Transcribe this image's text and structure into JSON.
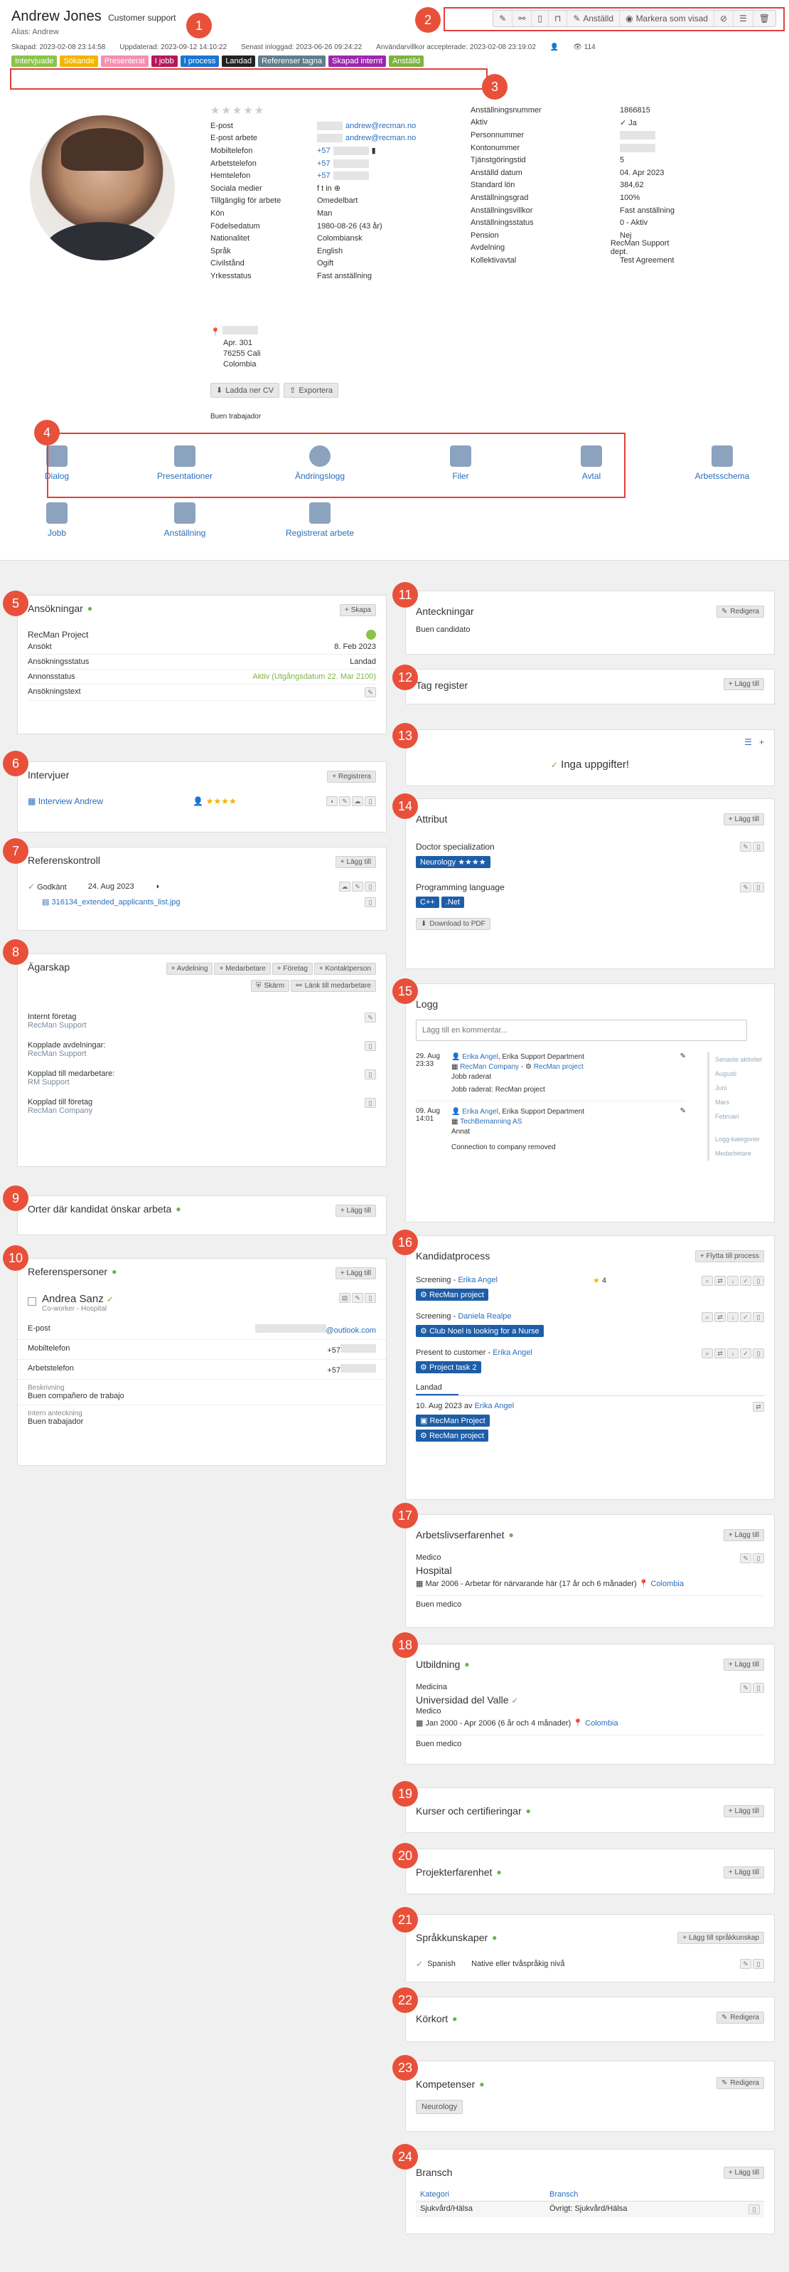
{
  "header": {
    "name": "Andrew Jones",
    "role": "Customer support",
    "alias": "Alias: Andrew",
    "meta": [
      "Skapad: 2023-02-08 23:14:58",
      "Uppdaterad: 2023-09-12 14:10:22",
      "Senast inloggad: 2023-06-26 09:24:22",
      "Användarvillkor accepterade: 2023-02-08 23:19:02"
    ],
    "views": "114"
  },
  "toolbar": {
    "employee": "Anställd",
    "mark_seen": "Markera som visad"
  },
  "tags": [
    {
      "label": "Intervjuade",
      "color": "#8bc34a"
    },
    {
      "label": "Sökande",
      "color": "#f4b400"
    },
    {
      "label": "Presenterat",
      "color": "#f48fb1"
    },
    {
      "label": "I jobb",
      "color": "#b5195b"
    },
    {
      "label": "I process",
      "color": "#1976d2"
    },
    {
      "label": "Landad",
      "color": "#222222"
    },
    {
      "label": "Referenser tagna",
      "color": "#607d8b"
    },
    {
      "label": "Skapad internt",
      "color": "#9c27b0"
    },
    {
      "label": "Anställd",
      "color": "#7cb342"
    }
  ],
  "profile": {
    "stars": "★★★★★",
    "fields": [
      {
        "label": "E-post",
        "value": "andrew@recman.no"
      },
      {
        "label": "E-post arbete",
        "value": "andrew@recman.no"
      },
      {
        "label": "Mobiltelefon",
        "value": "+57"
      },
      {
        "label": "Arbetstelefon",
        "value": "+57"
      },
      {
        "label": "Hemtelefon",
        "value": "+57"
      },
      {
        "label": "Sociala medier",
        "value": "f  t  in  ⊕"
      },
      {
        "label": "Tillgänglig för arbete",
        "value": "Omedelbart"
      },
      {
        "label": "Kön",
        "value": "Man"
      },
      {
        "label": "Födelsedatum",
        "value": "1980-08-26 (43 år)"
      },
      {
        "label": "Nationalitet",
        "value": "Colombiansk"
      },
      {
        "label": "Språk",
        "value": "English"
      },
      {
        "label": "Civilstånd",
        "value": "Ogift"
      },
      {
        "label": "Yrkesstatus",
        "value": "Fast anställning"
      }
    ],
    "right": [
      {
        "label": "Anställningsnummer",
        "value": "1866815"
      },
      {
        "label": "Aktiv",
        "value": "✓ Ja"
      },
      {
        "label": "Personnummer",
        "value": ""
      },
      {
        "label": "Kontonummer",
        "value": ""
      },
      {
        "label": "Tjänstgöringstid",
        "value": "5"
      },
      {
        "label": "Anställd datum",
        "value": "04. Apr 2023"
      },
      {
        "label": "Standard lön",
        "value": "384,62"
      },
      {
        "label": "Anställningsgrad",
        "value": "100%"
      },
      {
        "label": "Anställningsvillkor",
        "value": "Fast anställning"
      },
      {
        "label": "Anställningsstatus",
        "value": "0 - Aktiv"
      },
      {
        "label": "Pension",
        "value": "Nej"
      },
      {
        "label": "Avdelning",
        "value": "RecMan Support dept."
      },
      {
        "label": "Kollektivavtal",
        "value": "Test Agreement"
      }
    ],
    "address": [
      "Apr. 301",
      "76255 Cali",
      "Colombia"
    ],
    "upload_cv": "Ladda ner CV",
    "export": "Exportera",
    "note": "Buen trabajador"
  },
  "nav": [
    {
      "label": "Dialog"
    },
    {
      "label": "Presentationer"
    },
    {
      "label": "Ändringslogg"
    },
    {
      "label": "Filer"
    },
    {
      "label": "Avtal"
    },
    {
      "label": "Arbetsschema"
    },
    {
      "label": "Jobb"
    },
    {
      "label": "Anställning"
    },
    {
      "label": "Registrerat arbete"
    }
  ],
  "badges": [
    "1",
    "2",
    "3",
    "4",
    "5",
    "6",
    "7",
    "8",
    "9",
    "10",
    "11",
    "12",
    "13",
    "14",
    "15",
    "16",
    "17",
    "18",
    "19",
    "20",
    "21",
    "22",
    "23",
    "24"
  ],
  "applications": {
    "title": "Ansökningar",
    "create": "+ Skapa",
    "project": "RecMan Project",
    "rows": [
      {
        "k": "Ansökt",
        "v": "8. Feb 2023"
      },
      {
        "k": "Ansökningsstatus",
        "v": "Landad"
      },
      {
        "k": "Annonsstatus",
        "v": "Aktiv (Utgångsdatum 22. Mar 2100)"
      },
      {
        "k": "Ansökningstext",
        "v": ""
      }
    ]
  },
  "interviews": {
    "title": "Intervjuer",
    "register": "+ Registrera",
    "item": "Interview Andrew",
    "stars": "★★★★"
  },
  "reference_check": {
    "title": "Referenskontroll",
    "add": "+ Lägg till",
    "status": "Godkänt",
    "date": "24. Aug 2023",
    "file": "316134_extended_applicants_list.jpg"
  },
  "ownership": {
    "title": "Ägarskap",
    "buttons": [
      "+ Avdelning",
      "+ Medarbetare",
      "+ Företag",
      "+ Kontaktperson"
    ],
    "buttons2": [
      "Skärm",
      "Länk till medarbetare"
    ],
    "items": [
      {
        "label": "Internt företag",
        "value": "RecMan Support"
      },
      {
        "label": "Kopplade avdelningar:",
        "value": "RecMan Support"
      },
      {
        "label": "Kopplad till medarbetare:",
        "value": "RM Support"
      },
      {
        "label": "Kopplad till företag",
        "value": "RecMan Company"
      }
    ]
  },
  "locations": {
    "title": "Orter där kandidat önskar arbeta",
    "add": "+ Lägg till"
  },
  "references": {
    "title": "Referenspersoner",
    "add": "+ Lägg till",
    "name": "Andrea Sanz",
    "sub": "Co-worker - Hospital",
    "rows": [
      {
        "k": "E-post",
        "v": "@outlook.com"
      },
      {
        "k": "Mobiltelefon",
        "v": "+57"
      },
      {
        "k": "Arbetstelefon",
        "v": "+57"
      }
    ],
    "desc_label": "Beskrivning",
    "desc": "Buen compañero de trabajo",
    "note_label": "Intern anteckning",
    "note": "Buen trabajador"
  },
  "notes": {
    "title": "Anteckningar",
    "edit": "Redigera",
    "text": "Buen candidato"
  },
  "tagreg": {
    "title": "Tag register",
    "add": "+ Lägg till"
  },
  "tasks": {
    "empty": "Inga uppgifter!"
  },
  "attributes": {
    "title": "Attribut",
    "add": "+ Lägg till",
    "g1": "Doctor specialization",
    "g1v": "Neurology ★★★★",
    "g2": "Programming language",
    "g2v": [
      "C++",
      ".Net"
    ],
    "pdf": "Download to PDF"
  },
  "log": {
    "title": "Logg",
    "placeholder": "Lägg till en kommentar...",
    "entries": [
      {
        "date": "29. Aug",
        "time": "23:33",
        "who": "Erika Angel",
        "org": "Erika Support Department",
        "comp": "RecMan Company",
        "proj": "RecMan project",
        "act": "Jobb raderat",
        "msg": "Jobb raderat: RecMan project"
      },
      {
        "date": "09. Aug",
        "time": "14:01",
        "who": "Erika Angel",
        "org": "Erika Support Department",
        "comp": "TechBemanning AS",
        "act": "Annat",
        "msg": "Connection to company removed"
      }
    ],
    "side": [
      "Senaste aktivitet",
      "Augusti",
      "Juni",
      "Mars",
      "Februari",
      "Logg-kategorier",
      "Medarbetare"
    ]
  },
  "process": {
    "title": "Kandidatprocess",
    "move": "+ Flytta till process",
    "steps": [
      {
        "label": "Screening",
        "who": "Erika Angel",
        "chip": "RecMan project",
        "score": "4"
      },
      {
        "label": "Screening",
        "who": "Daniela Realpe",
        "chip": "Club Noel is looking for a Nurse"
      },
      {
        "label": "Present to customer",
        "who": "Erika Angel",
        "chip": "Project task 2"
      }
    ],
    "tab": "Landad",
    "landed": "10. Aug 2023 av",
    "landed_who": "Erika Angel",
    "chips": [
      "RecMan Project",
      "RecMan project"
    ]
  },
  "work": {
    "title": "Arbetslivserfarenhet",
    "add": "+ Lägg till",
    "role": "Medico",
    "org": "Hospital",
    "dates": "Mar 2006 - Arbetar för närvarande här",
    "dur": "(17 år och 6 månader)",
    "loc": "Colombia",
    "desc": "Buen medico"
  },
  "edu": {
    "title": "Utbildning",
    "add": "+ Lägg till",
    "field": "Medicina",
    "org": "Universidad del Valle",
    "deg": "Medico",
    "dates": "Jan 2000 - Apr 2006",
    "dur": "(6 år och 4 månader)",
    "loc": "Colombia",
    "desc": "Buen medico"
  },
  "courses": {
    "title": "Kurser och certifieringar",
    "add": "+ Lägg till"
  },
  "projects": {
    "title": "Projekterfarenhet",
    "add": "+ Lägg till"
  },
  "languages": {
    "title": "Språkkunskaper",
    "add": "+ Lägg till språkkunskap",
    "lang": "Spanish",
    "level": "Native eller tvåspråkig nivå"
  },
  "license": {
    "title": "Körkort",
    "edit": "Redigera"
  },
  "skills": {
    "title": "Kompetenser",
    "edit": "Redigera",
    "chip": "Neurology"
  },
  "industry": {
    "title": "Bransch",
    "add": "+ Lägg till",
    "h1": "Kategori",
    "h2": "Bransch",
    "c1": "Sjukvård/Hälsa",
    "c2": "Övrigt: Sjukvård/Hälsa"
  }
}
